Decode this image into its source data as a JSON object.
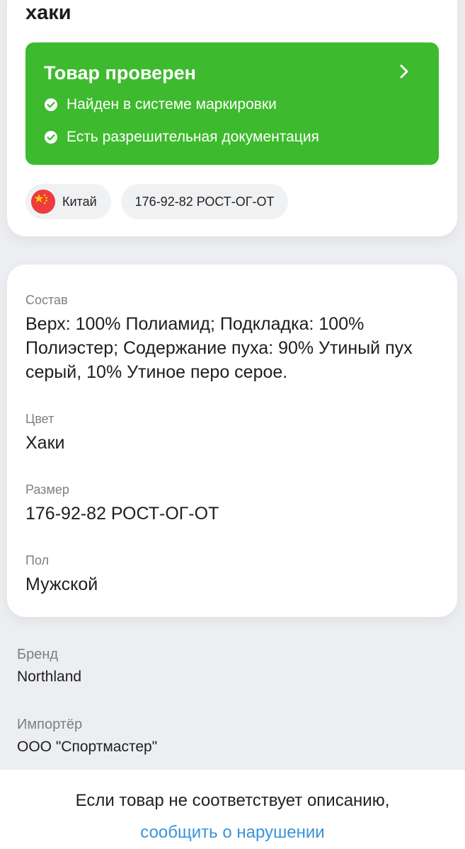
{
  "product": {
    "title_fragment": "хаки"
  },
  "verification": {
    "title": "Товар проверен",
    "checks": [
      "Найден в системе маркировки",
      "Есть разрешительная документация"
    ],
    "color": "#3dba2d"
  },
  "chips": {
    "country": "Китай",
    "country_icon": "china-flag-icon",
    "size": "176-92-82 РОСТ-ОГ-ОТ"
  },
  "details": {
    "composition_label": "Состав",
    "composition_value": "Верх: 100% Полиамид; Подкладка: 100% Полиэстер; Содержание пуха: 90% Утиный пух серый, 10% Утиное перо серое.",
    "color_label": "Цвет",
    "color_value": "Хаки",
    "size_label": "Размер",
    "size_value": "176-92-82 РОСТ-ОГ-ОТ",
    "gender_label": "Пол",
    "gender_value": "Мужской"
  },
  "brand": {
    "label": "Бренд",
    "value": "Northland"
  },
  "importer": {
    "label": "Импортёр",
    "value": "ООО \"Спортмастер\""
  },
  "footer": {
    "text": "Если товар не соответствует описанию,",
    "link": "сообщить о нарушении",
    "link_color": "#3a93d8"
  }
}
